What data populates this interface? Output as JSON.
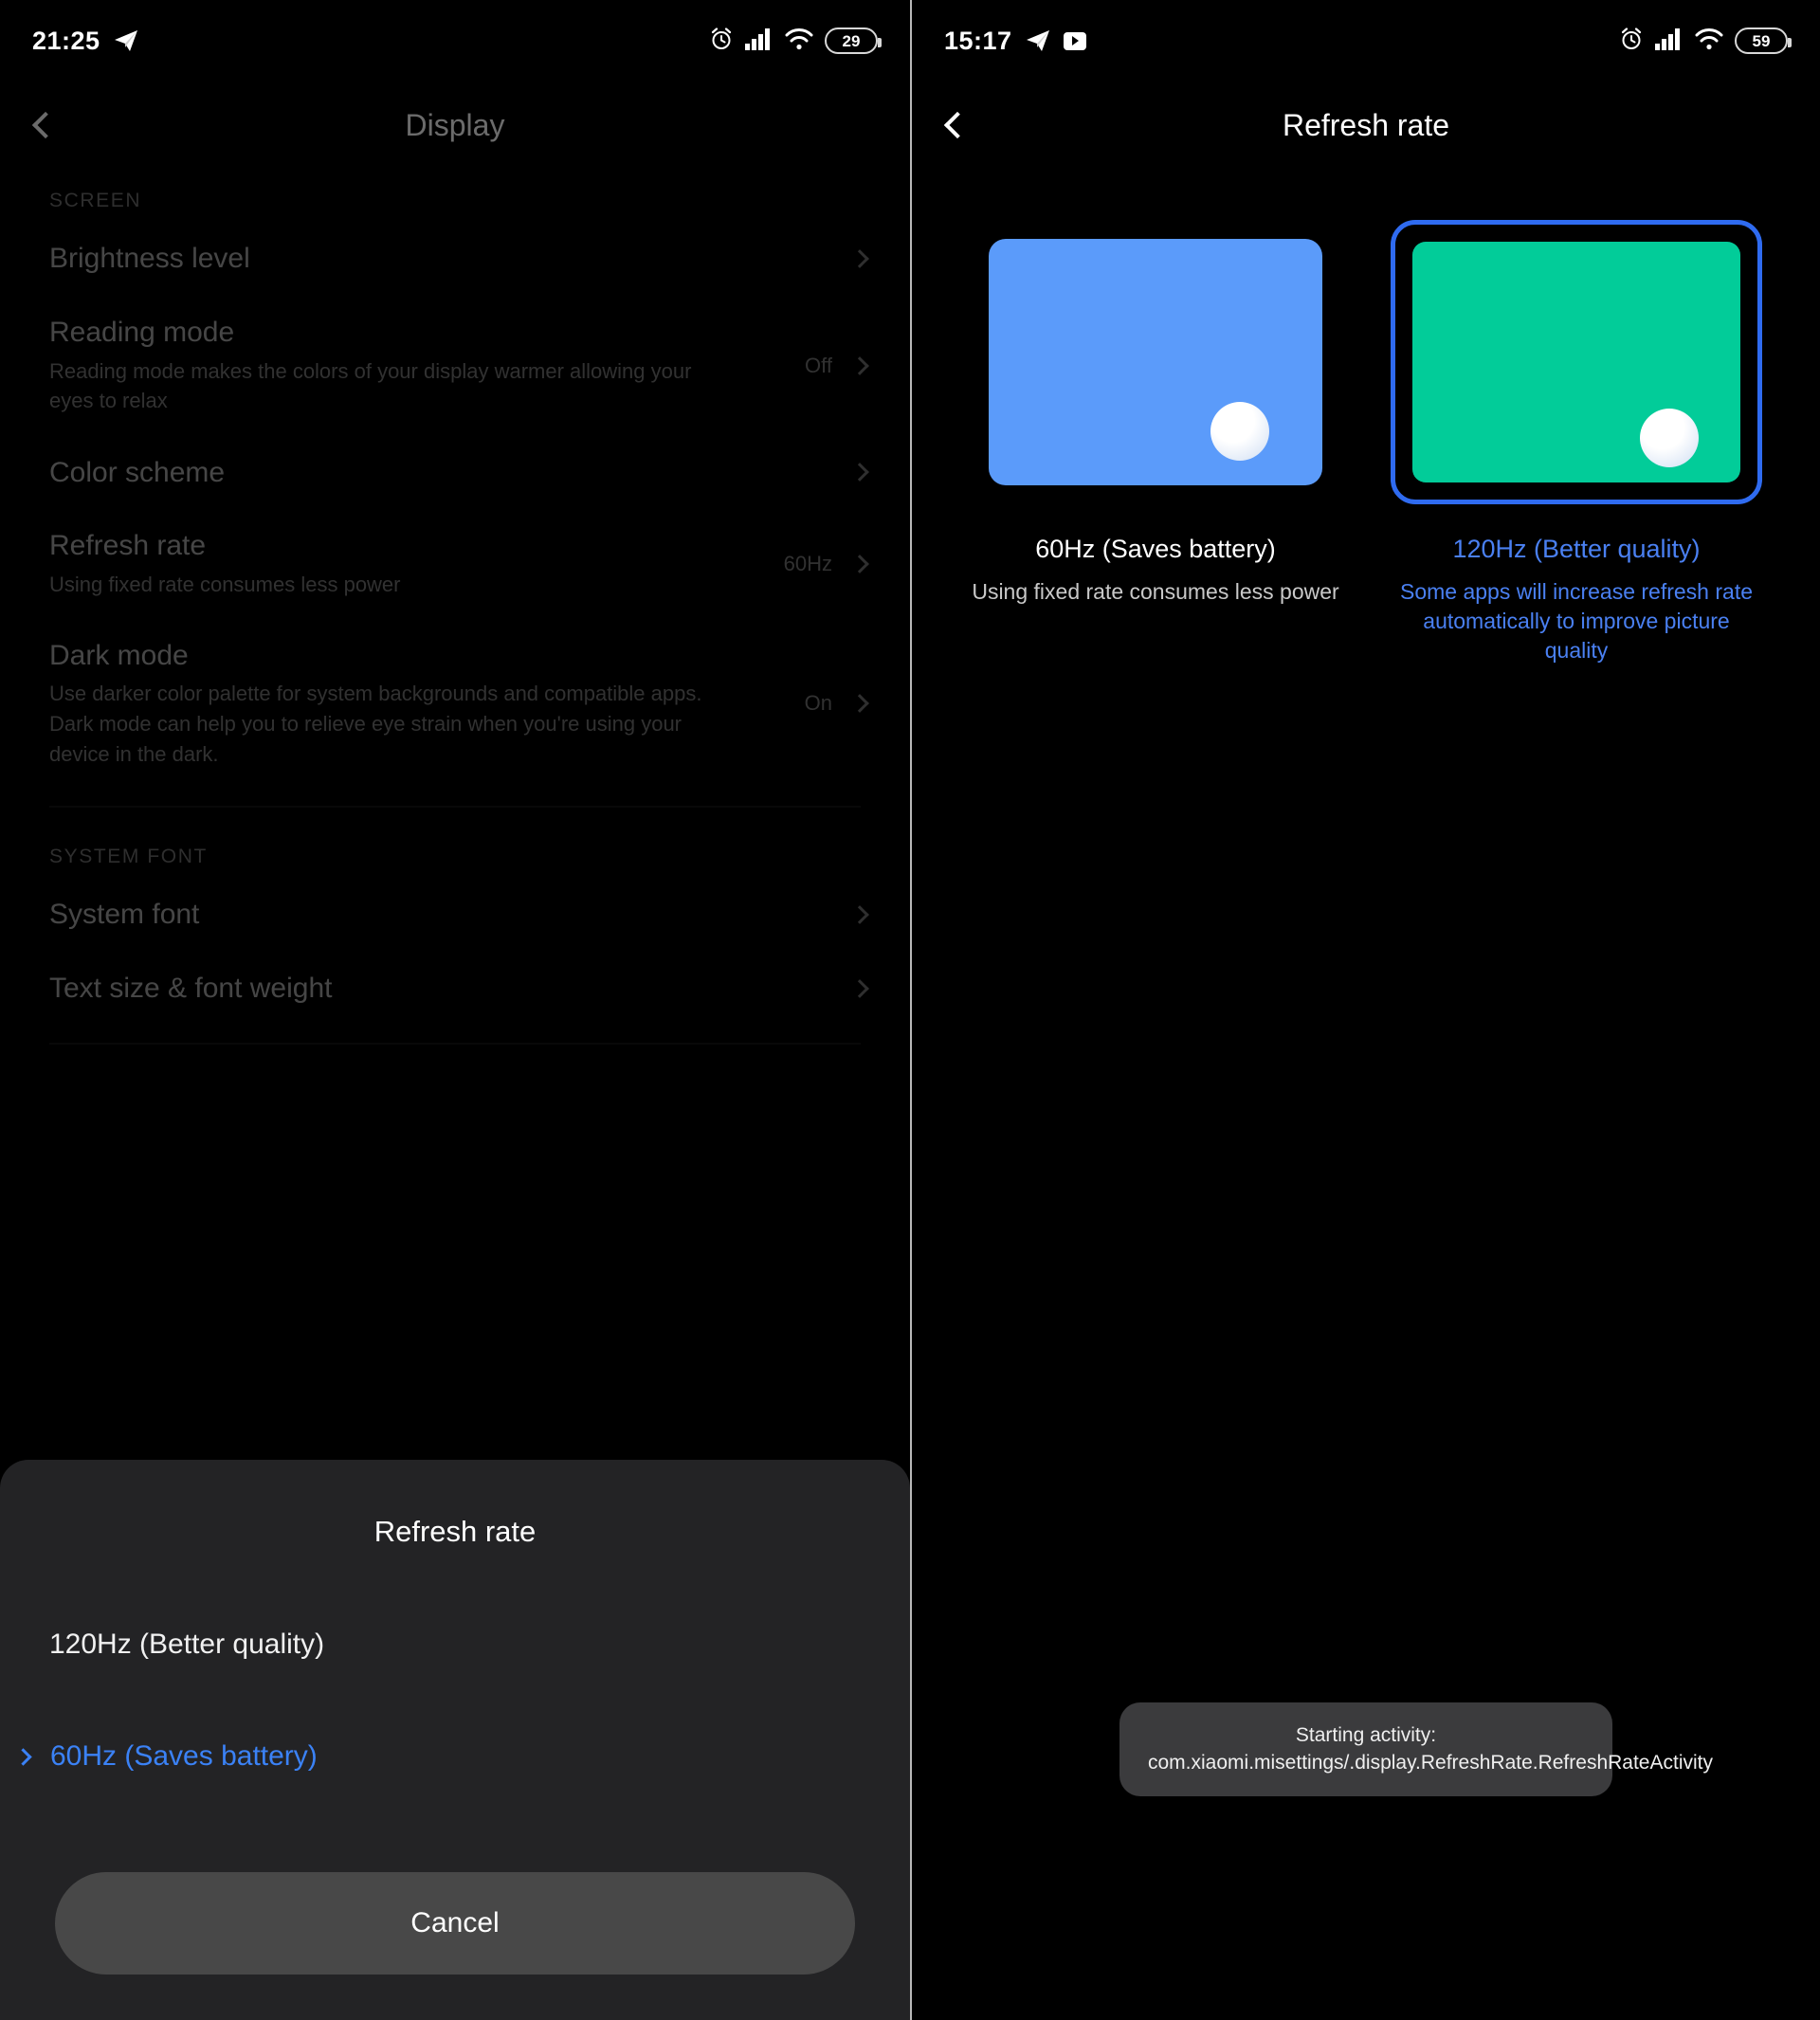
{
  "left": {
    "statusbar": {
      "time": "21:25",
      "icons": [
        "telegram-icon",
        "alarm-icon",
        "signal-icon",
        "wifi-icon",
        "battery-icon"
      ],
      "battery_level": "29"
    },
    "appbar": {
      "title": "Display",
      "back_label": "back-arrow"
    },
    "sections": [
      {
        "label": "SCREEN",
        "rows": [
          {
            "title": "Brightness level",
            "sub": "",
            "value": ""
          },
          {
            "title": "Reading mode",
            "sub": "Reading mode makes the colors of your display warmer allowing your eyes to relax",
            "value": "Off"
          },
          {
            "title": "Color scheme",
            "sub": "",
            "value": ""
          },
          {
            "title": "Refresh rate",
            "sub": "Using fixed rate consumes less power",
            "value": "60Hz"
          },
          {
            "title": "Dark mode",
            "sub": "Use darker color palette for system backgrounds and compatible apps. Dark mode can help you to relieve eye strain when you're using your device in the dark.",
            "value": "On"
          }
        ]
      },
      {
        "label": "SYSTEM FONT",
        "rows": [
          {
            "title": "System font",
            "sub": "",
            "value": ""
          },
          {
            "title": "Text size & font weight",
            "sub": "",
            "value": ""
          }
        ]
      }
    ],
    "sheet": {
      "title": "Refresh rate",
      "options": [
        {
          "label": "120Hz (Better quality)",
          "selected": false
        },
        {
          "label": "60Hz (Saves battery)",
          "selected": true
        }
      ],
      "cancel_label": "Cancel"
    }
  },
  "right": {
    "statusbar": {
      "time": "15:17",
      "icons": [
        "telegram-icon",
        "youtube-icon",
        "alarm-icon",
        "signal-icon",
        "wifi-icon",
        "battery-icon"
      ],
      "battery_level": "59"
    },
    "appbar": {
      "title": "Refresh rate",
      "back_label": "back-arrow"
    },
    "options": [
      {
        "label": "60Hz (Saves battery)",
        "desc": "Using fixed rate consumes less power",
        "color": "#5b9bfa",
        "selected": false
      },
      {
        "label": "120Hz (Better quality)",
        "desc": "Some apps will increase refresh rate automatically to improve picture quality",
        "color": "#02cc99",
        "selected": true
      }
    ],
    "toast": "Starting activity: com.xiaomi.misettings/.display.RefreshRate.RefreshRateActivity"
  },
  "colors": {
    "accent_blue": "#3b82f6",
    "selection_border": "#2f6bf0",
    "card_blue": "#5b9bfa",
    "card_green": "#02cc99",
    "sheet_bg": "#232325",
    "cancel_bg": "#484848"
  }
}
